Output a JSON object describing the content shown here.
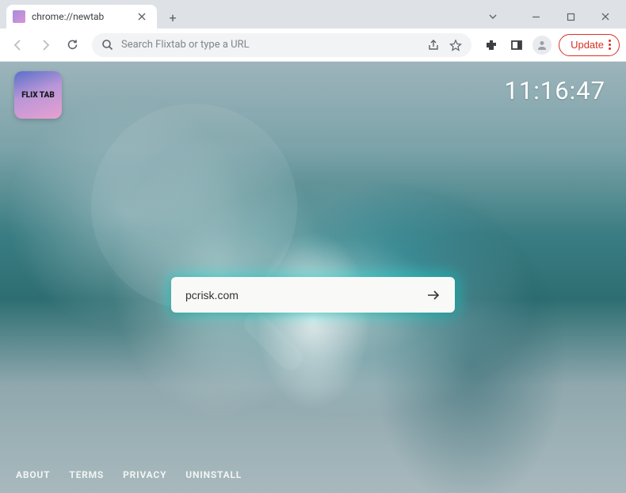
{
  "window": {
    "tab_title": "chrome://newtab"
  },
  "toolbar": {
    "omnibox_placeholder": "Search Flixtab or type a URL",
    "update_label": "Update"
  },
  "page": {
    "logo_text": "FLIX TAB",
    "clock": "11:16:47",
    "search_value": "pcrisk.com",
    "footer": [
      {
        "label": "ABOUT"
      },
      {
        "label": "TERMS"
      },
      {
        "label": "PRIVACY"
      },
      {
        "label": "UNINSTALL"
      }
    ]
  }
}
